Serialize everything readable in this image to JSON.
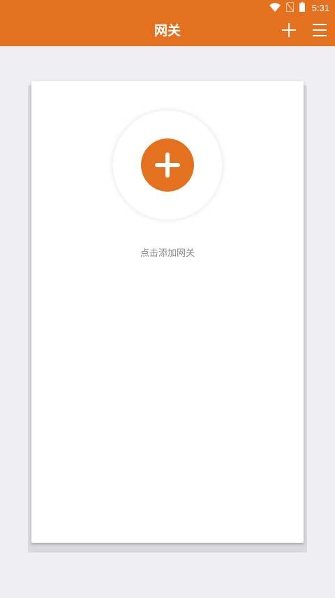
{
  "status_bar": {
    "time": "5:31",
    "icons": [
      "wifi-icon",
      "no-sim-icon",
      "battery-icon"
    ]
  },
  "app_bar": {
    "title": "网关",
    "actions": [
      "add-icon",
      "menu-icon"
    ]
  },
  "empty_state": {
    "add_icon": "plus-circle-icon",
    "hint": "点击添加网关"
  },
  "colors": {
    "accent": "#e4711f",
    "background": "#efeff3",
    "card": "#ffffff",
    "hint_text": "#8a8a8a"
  }
}
